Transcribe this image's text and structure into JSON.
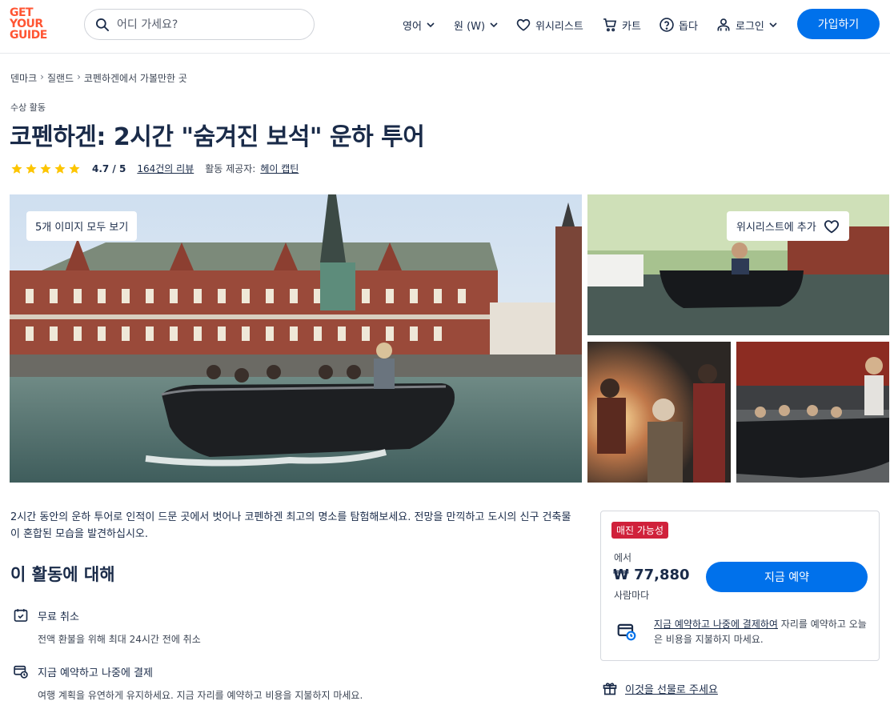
{
  "header": {
    "logo": [
      "GET",
      "YOUR",
      "GUIDE"
    ],
    "search_placeholder": "어디 가세요?",
    "language": "영어",
    "currency": "원 (W)",
    "wishlist": "위시리스트",
    "cart": "카트",
    "help": "돕다",
    "login": "로그인",
    "signup": "가입하기"
  },
  "breadcrumb": [
    "덴마크",
    "질랜드",
    "코펜하겐에서 가볼만한 곳"
  ],
  "activity": {
    "category": "수상 활동",
    "title": "코펜하겐: 2시간 \"숨겨진 보석\" 운하 투어",
    "rating": "4.7 / 5",
    "stars": 5,
    "reviews": "164건의 리뷰",
    "provider_label": "활동 제공자:",
    "provider": "헤이 캡틴"
  },
  "gallery": {
    "view_all": "5개 이미지 모두 보기",
    "add_wishlist": "위시리스트에 추가"
  },
  "description": "2시간 동안의 운하 투어로 인적이 드문 곳에서 벗어나 코펜하겐 최고의 명소를 탐험해보세요. 전망을 만끽하고 도시의 신구 건축물이 혼합된 모습을 발견하십시오.",
  "about": {
    "title": "이 활동에 대해",
    "features": [
      {
        "title": "무료 취소",
        "sub": "전액 환불을 위해 최대 24시간 전에 취소"
      },
      {
        "title": "지금 예약하고 나중에 결제",
        "sub": "여행 계획을 유연하게 유지하세요. 지금 자리를 예약하고 비용을 지불하지 마세요."
      }
    ]
  },
  "booking": {
    "badge": "매진 가능성",
    "from": "에서",
    "price": "₩ 77,880",
    "per": "사람마다",
    "book_now": "지금 예약",
    "later_link": "지금 예약하고 나중에 결제하여",
    "later_rest": " 자리를 예약하고 오늘은 비용을 지불하지 마세요.",
    "gift": "이것을 선물로 주세요"
  },
  "colors": {
    "brand": "#ff5533",
    "primary": "#0071eb",
    "badge": "#d0213b",
    "star": "#fdc500"
  }
}
